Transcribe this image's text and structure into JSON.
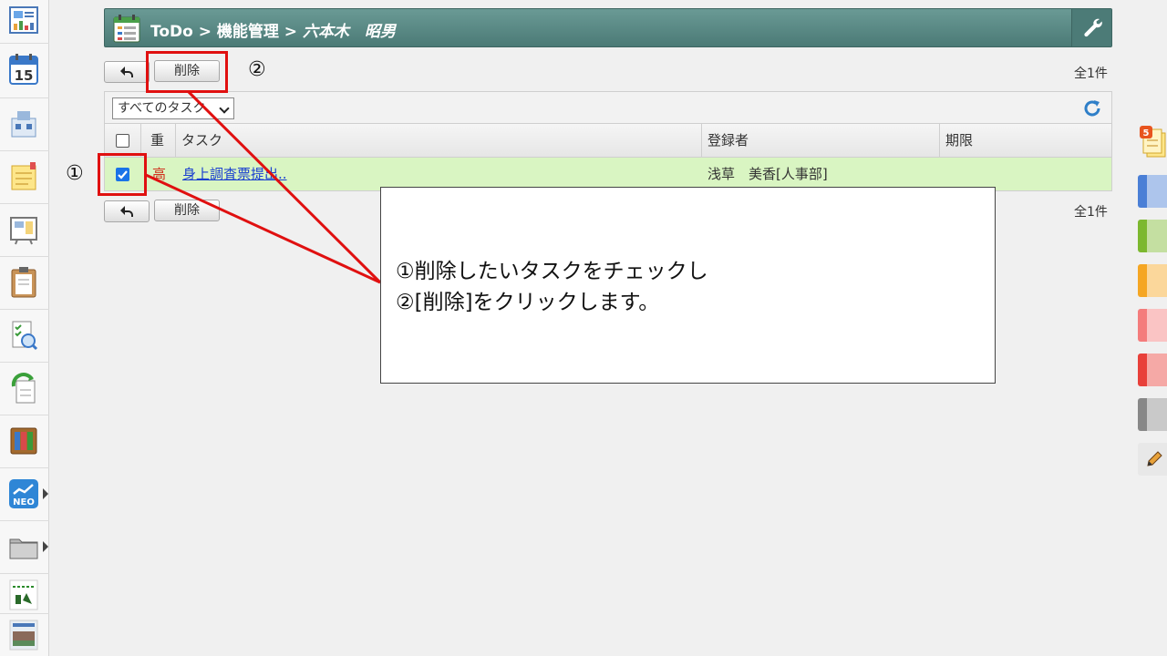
{
  "sidebar": {
    "items": [
      {
        "icon": "dashboard-icon"
      },
      {
        "icon": "calendar-icon",
        "text": "15"
      },
      {
        "icon": "facility-icon"
      },
      {
        "icon": "memo-icon"
      },
      {
        "icon": "bulletin-board-icon"
      },
      {
        "icon": "clipboard-icon"
      },
      {
        "icon": "search-document-icon"
      },
      {
        "icon": "workflow-icon"
      },
      {
        "icon": "cabinet-icon"
      },
      {
        "icon": "neo-chart-icon",
        "text": "NEO"
      },
      {
        "icon": "folder-icon"
      },
      {
        "icon": "monooki-icon"
      },
      {
        "icon": "building-icon"
      }
    ]
  },
  "header": {
    "breadcrumb_path": "ToDo > 機能管理 >",
    "user_name": "六本木　昭男",
    "settings_icon": "wrench-icon"
  },
  "toolbar": {
    "back_icon": "back-arrow-icon",
    "delete_label": "削除",
    "total_count": "全1件"
  },
  "filter": {
    "selected": "すべてのタスク"
  },
  "table": {
    "columns": [
      "重",
      "タスク",
      "登録者",
      "期限"
    ],
    "rows": [
      {
        "checked": true,
        "priority": "高",
        "task": "身上調査票提出..",
        "registrant": "浅草　美香[人事部]",
        "deadline": ""
      }
    ]
  },
  "annotations": {
    "marker_1": "①",
    "marker_2": "②",
    "callout_line1": "①削除したいタスクをチェックし",
    "callout_line2": "②[削除]をクリックします。"
  },
  "rightbar": {
    "badge": "5",
    "colors": [
      "#4a7fd6",
      "#7cb82f",
      "#f5a623",
      "#f47c7c",
      "#e8403a",
      "#888888"
    ]
  },
  "colors": {
    "header": "#5b8a86",
    "row_highlight": "#d9f5c2",
    "annotation_red": "#e01010",
    "link": "#1a3fd0",
    "priority_high": "#d0321e"
  }
}
